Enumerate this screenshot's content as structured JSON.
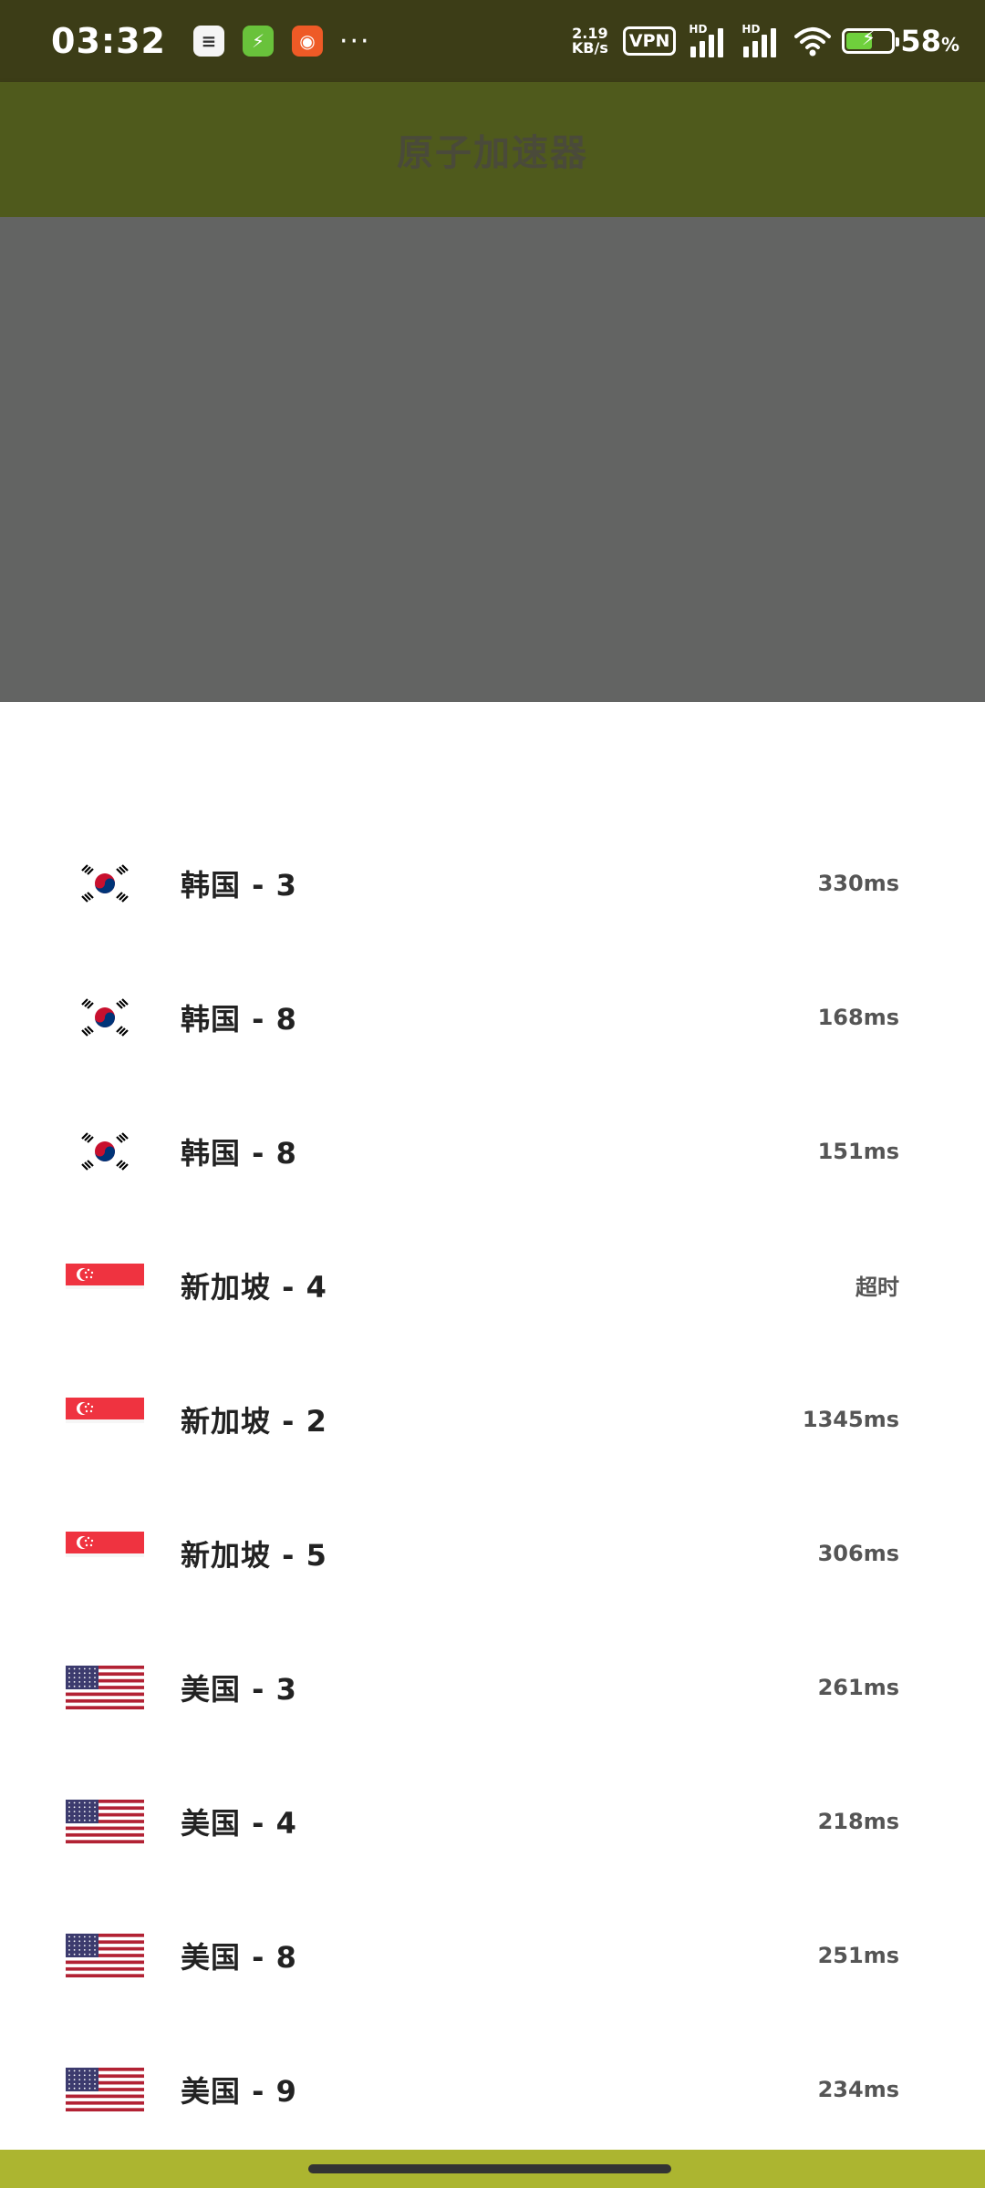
{
  "status_bar": {
    "time": "03:32",
    "app_icons": [
      "notes-app-icon",
      "charge-app-icon",
      "browser-app-icon"
    ],
    "more": "···",
    "net_speed_value": "2.19",
    "net_speed_unit": "KB/s",
    "vpn_label": "VPN",
    "signal_label": "HD",
    "battery_percent": "58",
    "battery_unit": "%",
    "battery_level": 0.58,
    "colors": {
      "background": "#3c3d17",
      "battery_fill": "#6fd03c"
    }
  },
  "app_bar": {
    "title": "原子加速器",
    "color": "#4f5a1c"
  },
  "servers": [
    {
      "flag": "korea-flag-icon",
      "name": "韩国 - 3",
      "latency": "330ms"
    },
    {
      "flag": "korea-flag-icon",
      "name": "韩国 - 8",
      "latency": "168ms"
    },
    {
      "flag": "korea-flag-icon",
      "name": "韩国 - 8",
      "latency": "151ms"
    },
    {
      "flag": "singapore-flag-icon",
      "name": "新加坡 - 4",
      "latency": "超时"
    },
    {
      "flag": "singapore-flag-icon",
      "name": "新加坡 - 2",
      "latency": "1345ms"
    },
    {
      "flag": "singapore-flag-icon",
      "name": "新加坡 - 5",
      "latency": "306ms"
    },
    {
      "flag": "usa-flag-icon",
      "name": "美国 - 3",
      "latency": "261ms"
    },
    {
      "flag": "usa-flag-icon",
      "name": "美国 - 4",
      "latency": "218ms"
    },
    {
      "flag": "usa-flag-icon",
      "name": "美国 - 8",
      "latency": "251ms"
    },
    {
      "flag": "usa-flag-icon",
      "name": "美国 - 9",
      "latency": "234ms"
    }
  ],
  "nav_bar": {
    "color": "#acb530"
  }
}
